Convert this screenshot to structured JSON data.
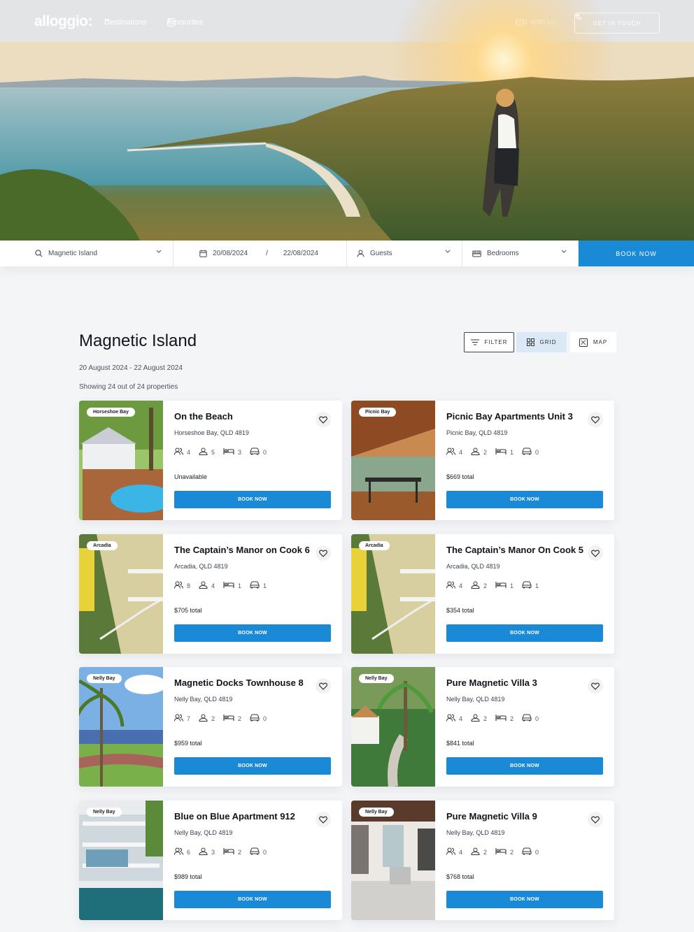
{
  "nav": {
    "logo": "alloggio:",
    "destinations": "Destinations",
    "favourites": "Favourites",
    "list_with_us": "List With Us",
    "get_in_touch": "GET IN TOUCH"
  },
  "search": {
    "location": "Magnetic Island",
    "date_from": "20/08/2024",
    "date_sep": "/",
    "date_to": "22/08/2024",
    "guests": "Guests",
    "bedrooms": "Bedrooms",
    "book_now": "BOOK NOW"
  },
  "results": {
    "title": "Magnetic Island",
    "dates": "20 August 2024 - 22 August 2024",
    "count": "Showing 24 out of 24 properties",
    "filter": "FILTER",
    "grid": "GRID",
    "map": "MAP"
  },
  "colors": {
    "accent": "#1a8ad6",
    "grid_active_bg": "#dbe9f6"
  },
  "listings": [
    {
      "tag": "Horseshoe Bay",
      "title": "On the Beach",
      "location": "Horseshoe Bay, QLD 4819",
      "guests": "4",
      "adults": "5",
      "beds": "3",
      "cars": "0",
      "price": "Unavailable",
      "book": "BOOK NOW"
    },
    {
      "tag": "Picnic Bay",
      "title": "Picnic Bay Apartments Unit 3",
      "location": "Picnic Bay, QLD 4819",
      "guests": "4",
      "adults": "2",
      "beds": "1",
      "cars": "0",
      "price": "$669 total",
      "book": "BOOK NOW"
    },
    {
      "tag": "Arcadia",
      "title": "The Captain’s Manor on Cook 6",
      "location": "Arcadia, QLD 4819",
      "guests": "8",
      "adults": "4",
      "beds": "1",
      "cars": "1",
      "price": "$705 total",
      "book": "BOOK NOW"
    },
    {
      "tag": "Arcadia",
      "title": "The Captain’s Manor On Cook 5",
      "location": "Arcadia, QLD 4819",
      "guests": "4",
      "adults": "2",
      "beds": "1",
      "cars": "1",
      "price": "$354 total",
      "book": "BOOK NOW"
    },
    {
      "tag": "Nelly Bay",
      "title": "Magnetic Docks Townhouse 8",
      "location": "Nelly Bay, QLD 4819",
      "guests": "7",
      "adults": "2",
      "beds": "2",
      "cars": "0",
      "price": "$959 total",
      "book": "BOOK NOW"
    },
    {
      "tag": "Nelly Bay",
      "title": "Pure Magnetic Villa 3",
      "location": "Nelly Bay, QLD 4819",
      "guests": "4",
      "adults": "2",
      "beds": "2",
      "cars": "0",
      "price": "$841 total",
      "book": "BOOK NOW"
    },
    {
      "tag": "Nelly Bay",
      "title": "Blue on Blue Apartment 912",
      "location": "Nelly Bay, QLD 4819",
      "guests": "6",
      "adults": "3",
      "beds": "2",
      "cars": "0",
      "price": "$989 total",
      "book": "BOOK NOW"
    },
    {
      "tag": "Nelly Bay",
      "title": "Pure Magnetic Villa 9",
      "location": "Nelly Bay, QLD 4819",
      "guests": "4",
      "adults": "2",
      "beds": "2",
      "cars": "0",
      "price": "$768 total",
      "book": "BOOK NOW"
    }
  ]
}
